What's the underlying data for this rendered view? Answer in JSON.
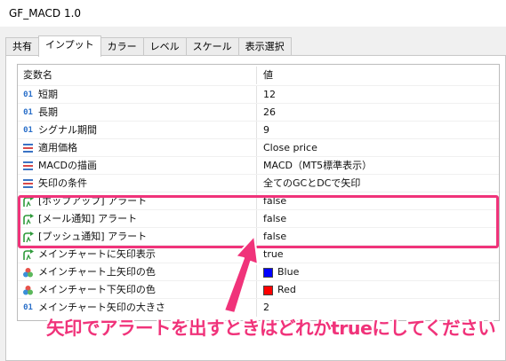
{
  "window": {
    "title": "GF_MACD 1.0"
  },
  "tabs": [
    {
      "label": "共有"
    },
    {
      "label": "インプット"
    },
    {
      "label": "カラー"
    },
    {
      "label": "レベル"
    },
    {
      "label": "スケール"
    },
    {
      "label": "表示選択"
    }
  ],
  "active_tab": "インプット",
  "grid": {
    "header": {
      "name": "変数名",
      "value": "値"
    },
    "rows": [
      {
        "icon": "integer-icon",
        "name": "短期",
        "value": "12"
      },
      {
        "icon": "integer-icon",
        "name": "長期",
        "value": "26"
      },
      {
        "icon": "integer-icon",
        "name": "シグナル期間",
        "value": "9"
      },
      {
        "icon": "enum-icon",
        "name": "適用価格",
        "value": "Close price"
      },
      {
        "icon": "enum-icon",
        "name": "MACDの描画",
        "value": "MACD（MT5標準表示）"
      },
      {
        "icon": "enum-icon",
        "name": "矢印の条件",
        "value": "全てのGCとDCで矢印"
      },
      {
        "icon": "bool-icon",
        "name": "[ポップアップ] アラート",
        "value": "false"
      },
      {
        "icon": "bool-icon",
        "name": "[メール通知] アラート",
        "value": "false"
      },
      {
        "icon": "bool-icon",
        "name": "[プッシュ通知] アラート",
        "value": "false"
      },
      {
        "icon": "bool-icon",
        "name": "メインチャートに矢印表示",
        "value": "true"
      },
      {
        "icon": "color-icon",
        "name": "メインチャート上矢印の色",
        "value": "Blue",
        "color": "#0000ff"
      },
      {
        "icon": "color-icon",
        "name": "メインチャート下矢印の色",
        "value": "Red",
        "color": "#ff0000"
      },
      {
        "icon": "integer-icon",
        "name": "メインチャート矢印の大きさ",
        "value": "2"
      }
    ]
  },
  "annotation": {
    "callout_text": "矢印でアラートを出すときはどれかtrueにしてください",
    "accent_color": "#f0337a"
  }
}
